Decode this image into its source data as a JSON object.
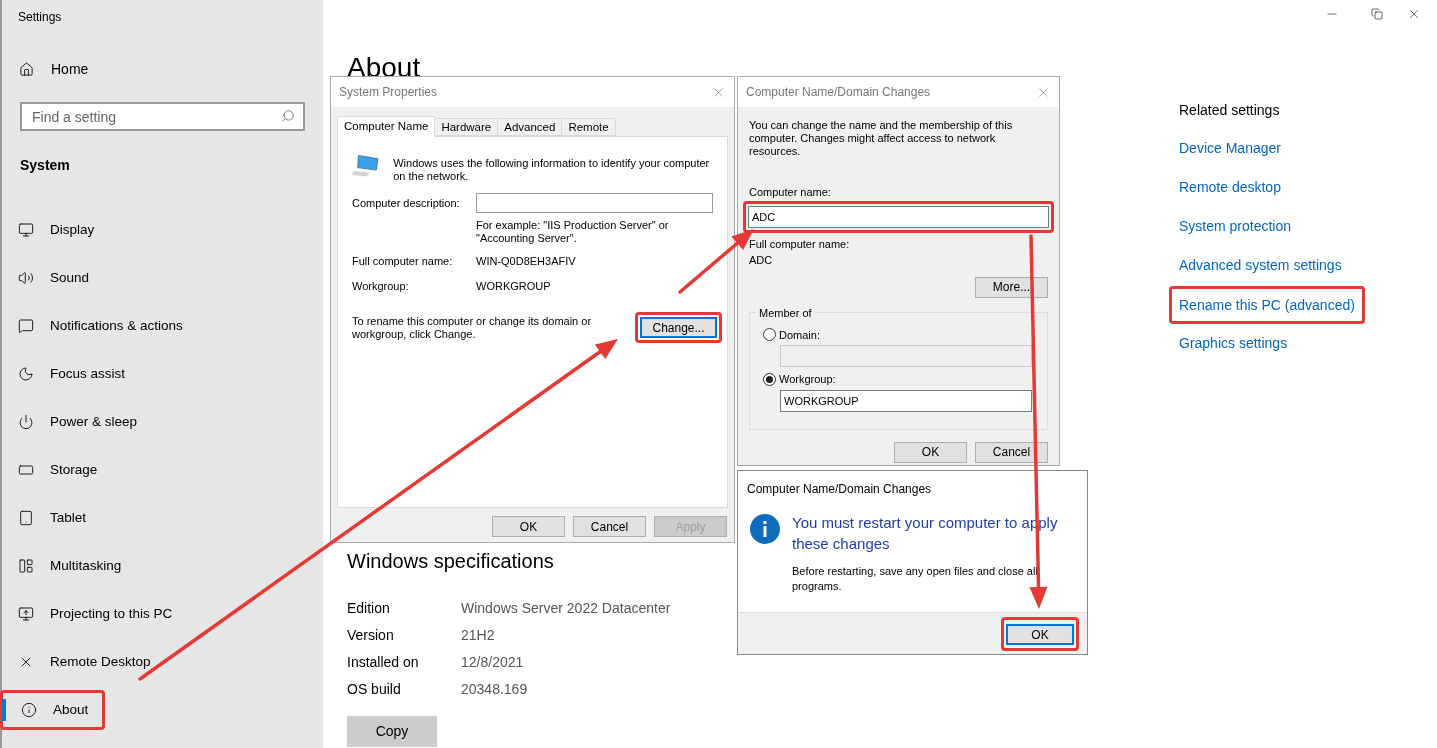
{
  "window": {
    "title": "Settings"
  },
  "sidebar": {
    "home": "Home",
    "search": {
      "placeholder": "Find a setting"
    },
    "section": "System",
    "items": [
      {
        "label": "Display",
        "selected": false,
        "highlighted": false
      },
      {
        "label": "Sound",
        "selected": false,
        "highlighted": false
      },
      {
        "label": "Notifications & actions",
        "selected": false,
        "highlighted": false
      },
      {
        "label": "Focus assist",
        "selected": false,
        "highlighted": false
      },
      {
        "label": "Power & sleep",
        "selected": false,
        "highlighted": false
      },
      {
        "label": "Storage",
        "selected": false,
        "highlighted": false
      },
      {
        "label": "Tablet",
        "selected": false,
        "highlighted": false
      },
      {
        "label": "Multitasking",
        "selected": false,
        "highlighted": false
      },
      {
        "label": "Projecting to this PC",
        "selected": false,
        "highlighted": false
      },
      {
        "label": "Remote Desktop",
        "selected": false,
        "highlighted": false
      },
      {
        "label": "About",
        "selected": true,
        "highlighted": true
      }
    ]
  },
  "main": {
    "heading": "About",
    "specs": {
      "title": "Windows specifications",
      "rows": [
        {
          "label": "Edition",
          "value": "Windows Server 2022 Datacenter"
        },
        {
          "label": "Version",
          "value": "21H2"
        },
        {
          "label": "Installed on",
          "value": "12/8/2021"
        },
        {
          "label": "OS build",
          "value": "20348.169"
        }
      ],
      "copy_button": "Copy"
    }
  },
  "related": {
    "title": "Related settings",
    "links": [
      {
        "label": "Device Manager",
        "highlighted": false
      },
      {
        "label": "Remote desktop",
        "highlighted": false
      },
      {
        "label": "System protection",
        "highlighted": false
      },
      {
        "label": "Advanced system settings",
        "highlighted": false
      },
      {
        "label": "Rename this PC (advanced)",
        "highlighted": true
      },
      {
        "label": "Graphics settings",
        "highlighted": false
      }
    ]
  },
  "system_properties": {
    "title": "System Properties",
    "tabs": [
      {
        "label": "Computer Name",
        "selected": true
      },
      {
        "label": "Hardware",
        "selected": false
      },
      {
        "label": "Advanced",
        "selected": false
      },
      {
        "label": "Remote",
        "selected": false
      }
    ],
    "intro": "Windows uses the following information to identify your computer on the network.",
    "description_label": "Computer description:",
    "example": "For example: \"IIS Production Server\" or \"Accounting Server\".",
    "fields": [
      {
        "label": "Full computer name:",
        "value": "WIN-Q0D8EH3AFIV"
      },
      {
        "label": "Workgroup:",
        "value": "WORKGROUP"
      }
    ],
    "rename_text": "To rename this computer or change its domain or workgroup, click Change.",
    "change_button": {
      "label": "Change...",
      "highlighted": true,
      "focused": true
    },
    "buttons": [
      {
        "label": "OK",
        "disabled": false
      },
      {
        "label": "Cancel",
        "disabled": false
      },
      {
        "label": "Apply",
        "disabled": true
      }
    ]
  },
  "name_changes": {
    "title": "Computer Name/Domain Changes",
    "intro": "You can change the name and the membership of this computer. Changes might affect access to network resources.",
    "computer_name": {
      "label": "Computer name:",
      "value": "ADC",
      "highlighted": true
    },
    "full_name": {
      "label": "Full computer name:",
      "value": "ADC"
    },
    "more_button": "More...",
    "member_of": {
      "title": "Member of",
      "options": [
        {
          "label": "Domain:",
          "selected": false
        },
        {
          "label": "Workgroup:",
          "selected": true,
          "value": "WORKGROUP"
        }
      ]
    },
    "buttons": [
      {
        "label": "OK"
      },
      {
        "label": "Cancel"
      }
    ]
  },
  "restart_dialog": {
    "title": "Computer Name/Domain Changes",
    "message": "You must restart your computer to apply these changes",
    "detail": "Before restarting, save any open files and close all programs.",
    "ok_button": {
      "label": "OK",
      "highlighted": true,
      "focused": true
    }
  }
}
